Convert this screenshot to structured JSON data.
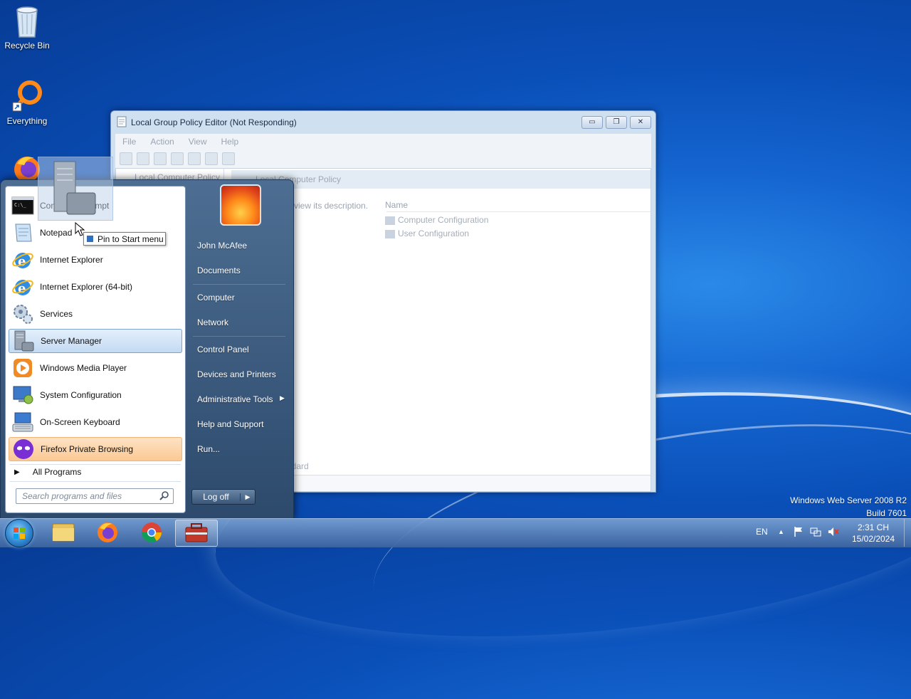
{
  "desktop": {
    "icons": [
      {
        "label": "Recycle Bin"
      },
      {
        "label": "Everything"
      }
    ],
    "watermark": {
      "line1": "Windows Web Server 2008 R2",
      "line2": "Build 7601"
    }
  },
  "window": {
    "title": "Local Group Policy Editor (Not Responding)",
    "menu": [
      "File",
      "Action",
      "View",
      "Help"
    ],
    "tree_root": "Local Computer Policy",
    "pane_title": "Local Computer Policy",
    "description_hint": "o view its description.",
    "column_name": "Name",
    "rows": [
      "Computer Configuration",
      "User Configuration"
    ],
    "bottom_tab": "ndard",
    "buttons": {
      "minimize": "▭",
      "maximize": "❐",
      "close": "✕"
    }
  },
  "start_menu": {
    "programs": [
      {
        "label": "Command Prompt",
        "icon": "cmd-icon"
      },
      {
        "label": "Notepad",
        "icon": "notepad-icon"
      },
      {
        "label": "Internet Explorer",
        "icon": "ie-icon"
      },
      {
        "label": "Internet Explorer (64-bit)",
        "icon": "ie-icon"
      },
      {
        "label": "Services",
        "icon": "services-icon"
      },
      {
        "label": "Server Manager",
        "icon": "server-manager-icon"
      },
      {
        "label": "Windows Media Player",
        "icon": "media-player-icon"
      },
      {
        "label": "System Configuration",
        "icon": "system-config-icon"
      },
      {
        "label": "On-Screen Keyboard",
        "icon": "keyboard-icon"
      },
      {
        "label": "Firefox Private Browsing",
        "icon": "firefox-private-icon"
      }
    ],
    "all_programs": "All Programs",
    "search_placeholder": "Search programs and files",
    "user": "John McAfee",
    "right_items": [
      "Documents",
      "Computer",
      "Network",
      "Control Panel",
      "Devices and Printers",
      "Administrative Tools",
      "Help and Support",
      "Run..."
    ],
    "logoff": "Log off",
    "tooltip": "Pin to Start menu"
  },
  "taskbar": {
    "language": "EN",
    "time": "2:31 CH",
    "date": "15/02/2024"
  },
  "colors": {
    "accent": "#1565d0",
    "highlight_orange": "#fbc994",
    "highlight_blue": "#c3daf3"
  }
}
